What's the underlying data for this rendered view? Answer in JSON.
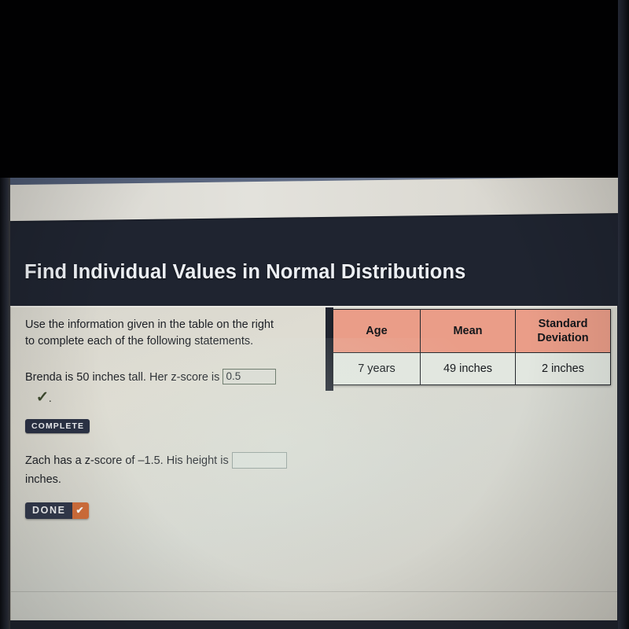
{
  "lesson": {
    "title": "Find Individual Values in Normal Distributions"
  },
  "instructions": {
    "line1": "Use the information given in the table on the right",
    "line2": "to complete each of the following statements."
  },
  "statement_1": {
    "text_before": "Brenda is 50 inches tall. Her z-score is",
    "answer_value": "0.5",
    "answer_placeholder": "",
    "check_icon": "✓",
    "trailing_period": ".",
    "status_badge": "COMPLETE"
  },
  "statement_2": {
    "text_before": "Zach has a z-score of –1.5. His height is",
    "answer_value": "",
    "answer_placeholder": "",
    "text_after": "inches."
  },
  "done_button": {
    "label": "DONE",
    "check_icon": "✔"
  },
  "table": {
    "headers": [
      "Age",
      "Mean",
      "Standard\nDeviation"
    ],
    "header_age": "Age",
    "header_mean": "Mean",
    "header_stdev_line1": "Standard",
    "header_stdev_line2": "Deviation",
    "rows": [
      {
        "age": "7 years",
        "mean": "49 inches",
        "stdev": "2 inches"
      }
    ]
  },
  "colors": {
    "header_bar": "#1f2430",
    "table_header": "#ea9d88",
    "table_cell": "#e2e7e0",
    "badge": "#2b3245",
    "done_accent": "#d4703c",
    "panel": "#dcdad2",
    "check_green": "#3d4a2e"
  }
}
